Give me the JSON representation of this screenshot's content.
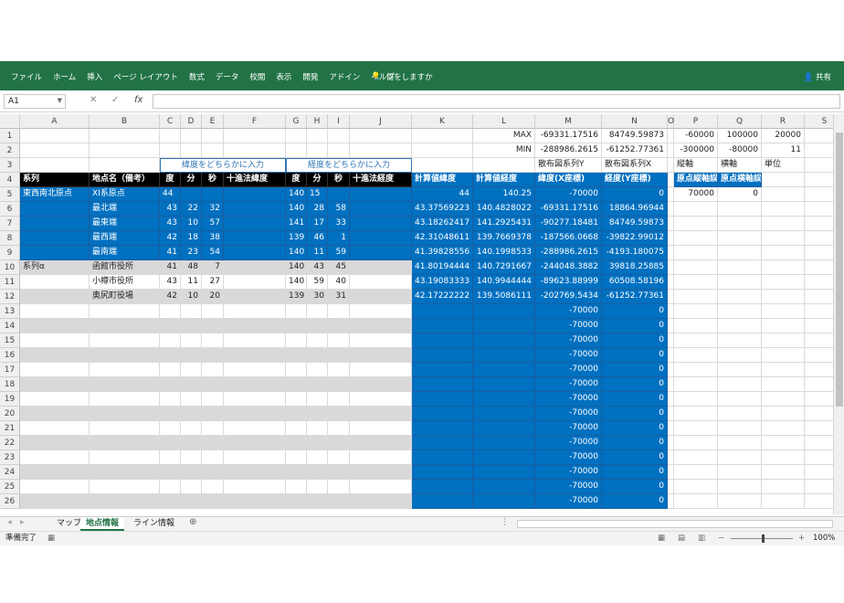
{
  "ribbon": {
    "tabs": [
      "ファイル",
      "ホーム",
      "挿入",
      "ページ レイアウト",
      "数式",
      "データ",
      "校閲",
      "表示",
      "開発",
      "アドイン",
      "ヘルプ"
    ],
    "tell_me": "何をしますか",
    "share": "共有"
  },
  "formula_bar": {
    "name_box": "A1",
    "cancel": "✕",
    "enter": "✓",
    "fx": "fx",
    "value": ""
  },
  "columns": [
    {
      "id": "A",
      "label": "A"
    },
    {
      "id": "B",
      "label": "B"
    },
    {
      "id": "C",
      "label": "C"
    },
    {
      "id": "D",
      "label": "D"
    },
    {
      "id": "E",
      "label": "E"
    },
    {
      "id": "F",
      "label": "F"
    },
    {
      "id": "G",
      "label": "G"
    },
    {
      "id": "H",
      "label": "H"
    },
    {
      "id": "I",
      "label": "I"
    },
    {
      "id": "J",
      "label": "J"
    },
    {
      "id": "K",
      "label": "K"
    },
    {
      "id": "L",
      "label": "L"
    },
    {
      "id": "M",
      "label": "M"
    },
    {
      "id": "N",
      "label": "N"
    },
    {
      "id": "O",
      "label": "O"
    },
    {
      "id": "P",
      "label": "P"
    },
    {
      "id": "Q",
      "label": "Q"
    },
    {
      "id": "R",
      "label": "R"
    },
    {
      "id": "S",
      "label": "S"
    }
  ],
  "row_numbers": [
    "1",
    "2",
    "3",
    "4",
    "5",
    "6",
    "7",
    "8",
    "9",
    "10",
    "11",
    "12",
    "13",
    "14",
    "15",
    "16",
    "17",
    "18",
    "19",
    "20",
    "21",
    "22",
    "23",
    "24",
    "25",
    "26"
  ],
  "rows": {
    "1": {
      "L": "MAX",
      "M": "-69331.17516",
      "N": "84749.59873",
      "P": "-60000",
      "Q": "100000",
      "R": "20000"
    },
    "2": {
      "L": "MIN",
      "M": "-288986.2615",
      "N": "-61252.77361",
      "P": "-300000",
      "Q": "-80000",
      "R": "11"
    },
    "3": {
      "C": "緯度をどちらかに入力",
      "G": "経度をどちらかに入力",
      "M": "散布図系列Y",
      "N": "散布図系列X",
      "P": "縦軸",
      "Q": "横軸",
      "R": "単位"
    },
    "4": {
      "A": "系列",
      "B": "地点名（備考）",
      "C": "度",
      "D": "分",
      "E": "秒",
      "F": "十進法緯度",
      "G": "度",
      "H": "分",
      "I": "秒",
      "J": "十進法経度",
      "K": "計算値緯度",
      "L": "計算値経度",
      "M": "緯度(X座標)",
      "N": "経度(Y座標)",
      "P": "原点縦軸誤",
      "Q": "原点横軸誤"
    },
    "5": {
      "A": "東西南北原点",
      "B": "XI系原点",
      "C": "44",
      "G": "140",
      "H": "15",
      "K": "44",
      "L": "140.25",
      "M": "-70000",
      "N": "0",
      "P": "70000",
      "Q": "0"
    },
    "6": {
      "B": "最北端",
      "C": "43",
      "D": "22",
      "E": "32",
      "G": "140",
      "H": "28",
      "I": "58",
      "K": "43.37569223",
      "L": "140.4828022",
      "M": "-69331.17516",
      "N": "18864.96944"
    },
    "7": {
      "B": "最東端",
      "C": "43",
      "D": "10",
      "E": "57",
      "G": "141",
      "H": "17",
      "I": "33",
      "K": "43.18262417",
      "L": "141.2925431",
      "M": "-90277.18481",
      "N": "84749.59873"
    },
    "8": {
      "B": "最西端",
      "C": "42",
      "D": "18",
      "E": "38",
      "G": "139",
      "H": "46",
      "I": "1",
      "K": "42.31048611",
      "L": "139.7669378",
      "M": "-187566.0668",
      "N": "-39822.99012"
    },
    "9": {
      "B": "最南端",
      "C": "41",
      "D": "23",
      "E": "54",
      "G": "140",
      "H": "11",
      "I": "59",
      "K": "41.39828556",
      "L": "140.1998533",
      "M": "-288986.2615",
      "N": "-4193.180075"
    },
    "10": {
      "A": "系列α",
      "B": "函館市役所",
      "C": "41",
      "D": "48",
      "E": "7",
      "G": "140",
      "H": "43",
      "I": "45",
      "K": "41.80194444",
      "L": "140.7291667",
      "M": "-244048.3882",
      "N": "39818.25885"
    },
    "11": {
      "B": "小樽市役所",
      "C": "43",
      "D": "11",
      "E": "27",
      "G": "140",
      "H": "59",
      "I": "40",
      "K": "43.19083333",
      "L": "140.9944444",
      "M": "-89623.88999",
      "N": "60508.58196"
    },
    "12": {
      "B": "奥尻町役場",
      "C": "42",
      "D": "10",
      "E": "20",
      "G": "139",
      "H": "30",
      "I": "31",
      "K": "42.17222222",
      "L": "139.5086111",
      "M": "-202769.5434",
      "N": "-61252.77361"
    },
    "13": {
      "M": "-70000",
      "N": "0"
    },
    "14": {
      "M": "-70000",
      "N": "0"
    },
    "15": {
      "M": "-70000",
      "N": "0"
    },
    "16": {
      "M": "-70000",
      "N": "0"
    },
    "17": {
      "M": "-70000",
      "N": "0"
    },
    "18": {
      "M": "-70000",
      "N": "0"
    },
    "19": {
      "M": "-70000",
      "N": "0"
    },
    "20": {
      "M": "-70000",
      "N": "0"
    },
    "21": {
      "M": "-70000",
      "N": "0"
    },
    "22": {
      "M": "-70000",
      "N": "0"
    },
    "23": {
      "M": "-70000",
      "N": "0"
    },
    "24": {
      "M": "-70000",
      "N": "0"
    },
    "25": {
      "M": "-70000",
      "N": "0"
    },
    "26": {
      "M": "-70000",
      "N": "0"
    }
  },
  "sheet_tabs": [
    "マップ",
    "地点情報",
    "ライン情報"
  ],
  "active_sheet": "地点情報",
  "status": {
    "ready": "準備完了",
    "zoom": "100%"
  },
  "colors": {
    "ribbon": "#217346",
    "blue_fill": "#0070c0",
    "header_black": "#000000",
    "gray_fill": "#d9d9d9"
  }
}
